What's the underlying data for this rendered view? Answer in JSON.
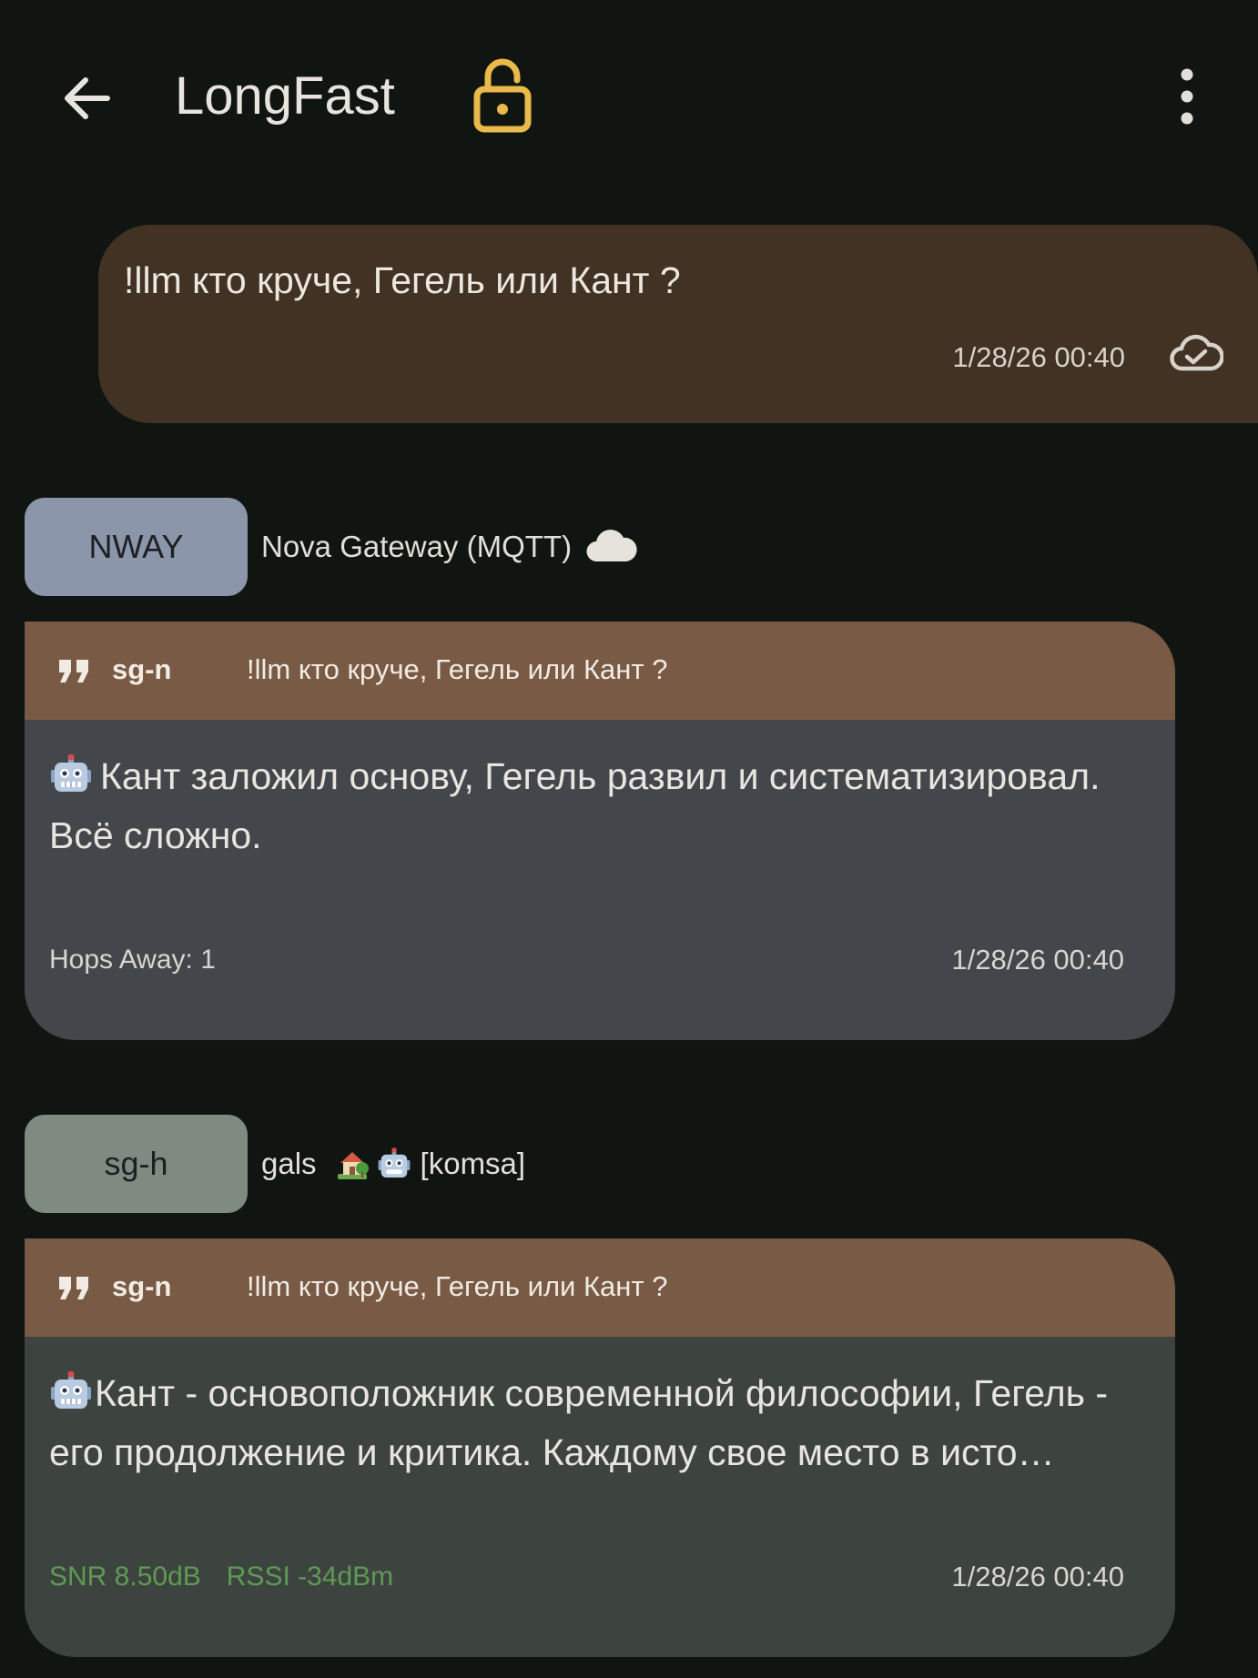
{
  "header": {
    "title": "LongFast",
    "back_icon": "arrow-left-icon",
    "lock_icon": "lock-open-icon",
    "lock_color": "#e9b949",
    "menu_icon": "more-vertical-icon"
  },
  "outgoing": {
    "text": "!llm кто круче, Гегель или Кант ?",
    "time": "1/28/26 00:40",
    "status_icon": "cloud-check-icon",
    "bubble_color": "#413224"
  },
  "messages": [
    {
      "avatar_label": "NWAY",
      "avatar_color": "#8c96aa",
      "sender": "Nova Gateway (MQTT)",
      "sender_icon": "cloud-icon",
      "reply_user": "sg-n",
      "reply_text": "!llm кто круче, Гегель или Кант ?",
      "text": "Кант заложил основу, Гегель развил и систематизировал. Всё сложно.",
      "text_icon": "robot-emoji-icon",
      "meta": "Hops Away: 1",
      "time": "1/28/26 00:40",
      "card_color": "#43474c"
    },
    {
      "avatar_label": "sg-h",
      "avatar_color": "#7f8a80",
      "sender": "gals",
      "sender_suffix": "[komsa]",
      "sender_icons": [
        "house-with-garden-emoji-icon",
        "robot-emoji-icon"
      ],
      "reply_user": "sg-n",
      "reply_text": "!llm кто круче, Гегель или Кант ?",
      "text": "Кант - основоположник современной философии, Гегель - его продолжение и критика. Каждому свое место в исто…",
      "text_icon": "robot-emoji-icon",
      "snr": "SNR 8.50dB",
      "rssi": "RSSI -34dBm",
      "signal_color": "#5f9a55",
      "time": "1/28/26 00:40",
      "card_color": "#3d4440"
    }
  ],
  "reply_header_color": "#785a45"
}
